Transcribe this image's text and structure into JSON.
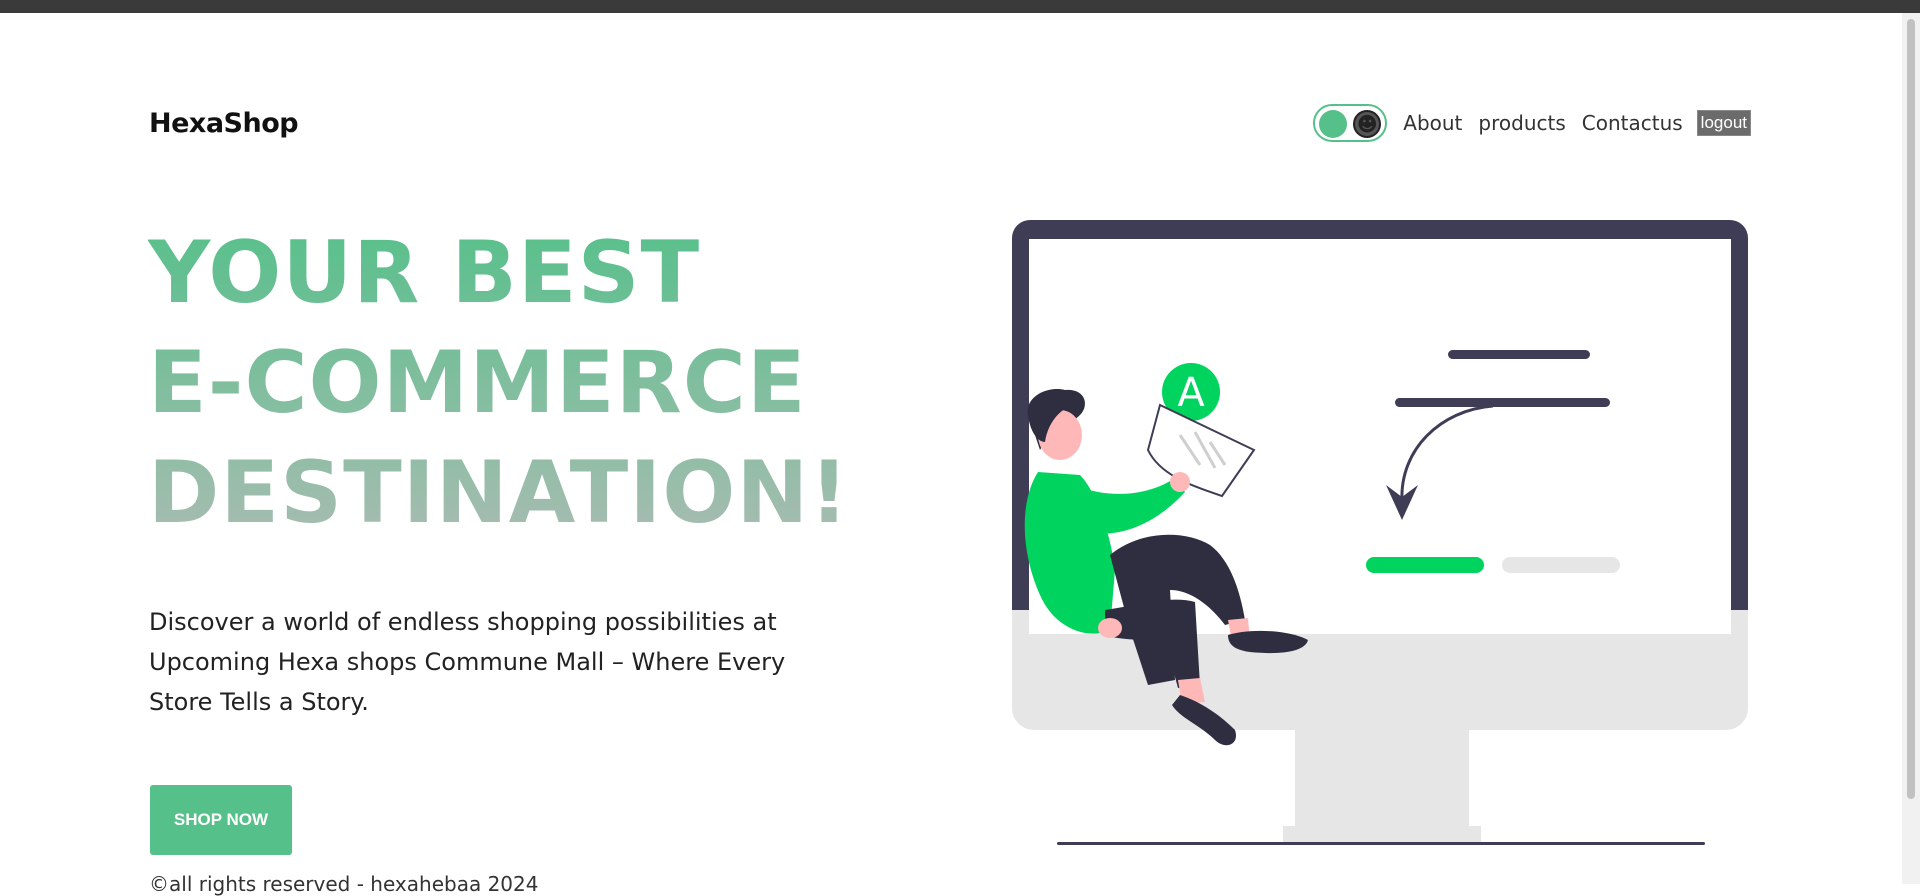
{
  "header": {
    "logo": "HexaShop",
    "nav": [
      {
        "label": "About"
      },
      {
        "label": "products"
      },
      {
        "label": "Contactus"
      }
    ],
    "logout_label": "logout",
    "theme_toggle": {
      "icons": [
        "light-knob",
        "dark-face-icon"
      ],
      "face_glyph": "☻"
    }
  },
  "hero": {
    "title_lines": [
      "YOUR BEST",
      "E-COMMERCE",
      "DESTINATION!"
    ],
    "description": "Discover a world of endless shopping possibilities at Upcoming Hexa shops Commune Mall – Where Every Store Tells a Story.",
    "cta_label": "SHOP NOW",
    "illustration_letter": "A"
  },
  "footer": {
    "text": "©all rights reserved - hexahebaa 2024"
  },
  "colors": {
    "accent": "#56c08a",
    "illustration_green": "#00d45f",
    "dark": "#3f3d56",
    "gray": "#e6e6e6"
  }
}
